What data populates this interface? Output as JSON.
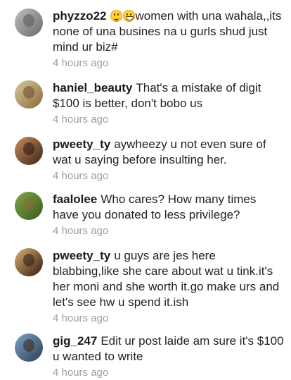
{
  "comments": [
    {
      "username": "phyzzo22",
      "emojis": [
        "smiling-face-icon",
        "grinning-face-icon"
      ],
      "text": "women with una wahala,,its none of una busines na u gurls shud just mind ur biz#",
      "time": "4 hours ago",
      "avatar_colors": [
        "#bdbdbd",
        "#6b6b6b"
      ]
    },
    {
      "username": "haniel_beauty",
      "text": "That's a mistake of digit $100 is better, don't bobo us",
      "time": "4 hours ago",
      "avatar_colors": [
        "#d8c89a",
        "#8a6a3c"
      ]
    },
    {
      "username": "pweety_ty",
      "text": "aywheezy u not even sure of wat u saying before insulting her.",
      "time": "4 hours ago",
      "avatar_colors": [
        "#c98e5c",
        "#3a2418"
      ]
    },
    {
      "username": "faalolee",
      "text": "Who cares? How many times have you donated to less privilege?",
      "time": "4 hours ago",
      "avatar_colors": [
        "#7fa54a",
        "#3d5a1e"
      ]
    },
    {
      "username": "pweety_ty",
      "text": "u guys are jes here blabbing,like she care about wat u tink.it's her moni and she worth it.go make urs and let's see hw u spend it.ish",
      "time": "4 hours ago",
      "avatar_colors": [
        "#e0b070",
        "#2e1b10"
      ]
    },
    {
      "username": "gig_247",
      "text": "Edit ur post laide am sure it's $100 u wanted to write",
      "time": "4 hours ago",
      "avatar_colors": [
        "#7ea1c4",
        "#2d3f55"
      ]
    }
  ]
}
